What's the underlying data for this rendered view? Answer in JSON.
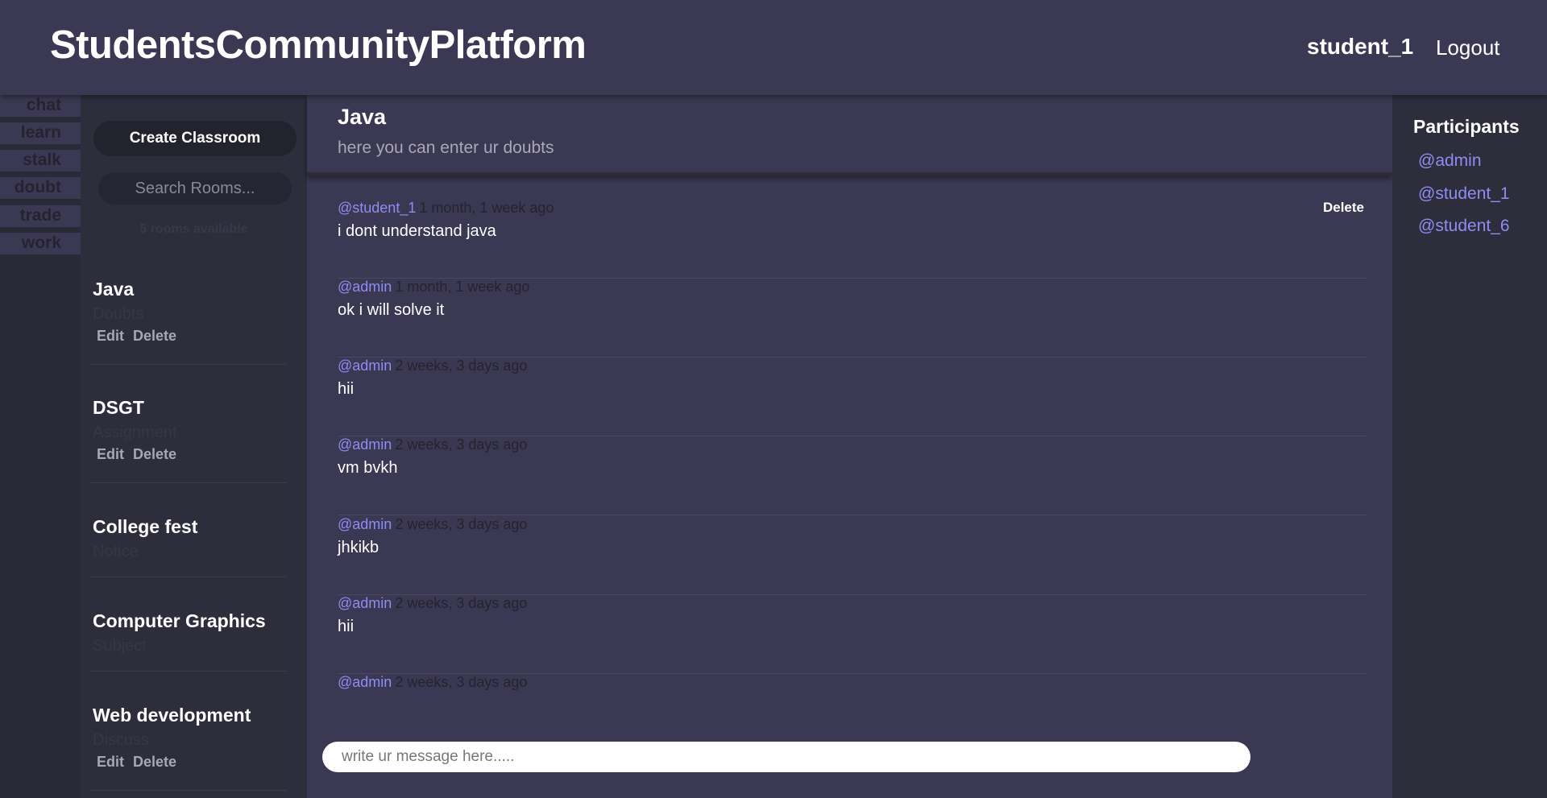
{
  "header": {
    "brand": "StudentsCommunityPlatform",
    "username": "student_1",
    "logout_label": "Logout"
  },
  "tabs": [
    "chat",
    "learn",
    "stalk",
    "doubt",
    "trade",
    "work"
  ],
  "sidebar": {
    "create_label": "Create Classroom",
    "search_placeholder": "Search Rooms...",
    "rooms_count": "5 rooms available",
    "rooms": [
      {
        "name": "Java",
        "topic": "Doubts",
        "edit": "Edit",
        "delete": "Delete"
      },
      {
        "name": "DSGT",
        "topic": "Assignment",
        "edit": "Edit",
        "delete": "Delete"
      },
      {
        "name": "College fest",
        "topic": "Notice",
        "edit": "",
        "delete": ""
      },
      {
        "name": "Computer Graphics",
        "topic": "Subject",
        "edit": "",
        "delete": ""
      },
      {
        "name": "Web development",
        "topic": "Discuss",
        "edit": "Edit",
        "delete": "Delete"
      }
    ]
  },
  "room": {
    "title": "Java",
    "description": "here you can enter ur doubts"
  },
  "messages": [
    {
      "user": "@student_1",
      "time": "1 month, 1 week ago",
      "body": "i dont understand java",
      "delete": "Delete"
    },
    {
      "user": "@admin",
      "time": "1 month, 1 week ago",
      "body": "ok i will solve it",
      "delete": ""
    },
    {
      "user": "@admin",
      "time": "2 weeks, 3 days ago",
      "body": "hii",
      "delete": ""
    },
    {
      "user": "@admin",
      "time": "2 weeks, 3 days ago",
      "body": "vm bvkh",
      "delete": ""
    },
    {
      "user": "@admin",
      "time": "2 weeks, 3 days ago",
      "body": "jhkikb",
      "delete": ""
    },
    {
      "user": "@admin",
      "time": "2 weeks, 3 days ago",
      "body": "hii",
      "delete": ""
    },
    {
      "user": "@admin",
      "time": "2 weeks, 3 days ago",
      "body": "",
      "delete": ""
    }
  ],
  "composer": {
    "placeholder": "write ur message here....."
  },
  "participants": {
    "title": "Participants",
    "items": [
      "@admin",
      "@student_1",
      "@student_6"
    ]
  },
  "colors": {
    "header_bg": "#3b3853",
    "sidebar_bg": "#2d2d3c",
    "accent_username": "#8f8cf2"
  }
}
